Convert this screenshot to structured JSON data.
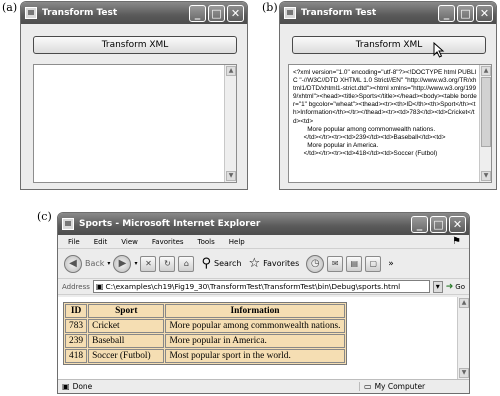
{
  "panel_labels": {
    "a": "(a)",
    "b": "(b)",
    "c": "(c)"
  },
  "window_a": {
    "title": "Transform Test",
    "button_label": "Transform XML",
    "output_text": ""
  },
  "window_b": {
    "title": "Transform Test",
    "button_label": "Transform XML",
    "output_text": "<?xml version=\"1.0\" encoding=\"utf-8\"?><!DOCTYPE html PUBLIC \"-//W3C//DTD XHTML 1.0 Strict//EN\" \"http://www.w3.org/TR/xhtml1/DTD/xhtml1-strict.dtd\"><html xmlns=\"http://www.w3.org/1999/xhtml\"><head><title>Sports</title></head><body><table border=\"1\" bgcolor=\"wheat\"><thead><tr><th>ID</th><th>Sport</th><th>Information</th></tr></thead><tr><td>783</td><td>Cricket</td><td>\n        More popular among commonwealth nations.\n      </td></tr><tr><td>239</td><td>Baseball</td><td>\n        More popular in America.\n      </td></tr><tr><td>418</td><td>Soccer (Futbol)"
  },
  "window_c": {
    "title": "Sports - Microsoft Internet Explorer",
    "menu": [
      "File",
      "Edit",
      "View",
      "Favorites",
      "Tools",
      "Help"
    ],
    "toolbar": {
      "back": "Back",
      "search": "Search",
      "favorites": "Favorites"
    },
    "address_label": "Address",
    "address_value": "C:\\examples\\ch19\\Fig19_30\\TransformTest\\TransformTest\\bin\\Debug\\sports.html",
    "go_label": "Go",
    "table": {
      "headers": [
        "ID",
        "Sport",
        "Information"
      ],
      "rows": [
        [
          "783",
          "Cricket",
          "More popular among commonwealth nations."
        ],
        [
          "239",
          "Baseball",
          "More popular in America."
        ],
        [
          "418",
          "Soccer (Futbol)",
          "Most popular sport in the world."
        ]
      ],
      "bgcolor": "#f5deb3"
    },
    "status_text": "Done",
    "status_zone": "My Computer"
  }
}
